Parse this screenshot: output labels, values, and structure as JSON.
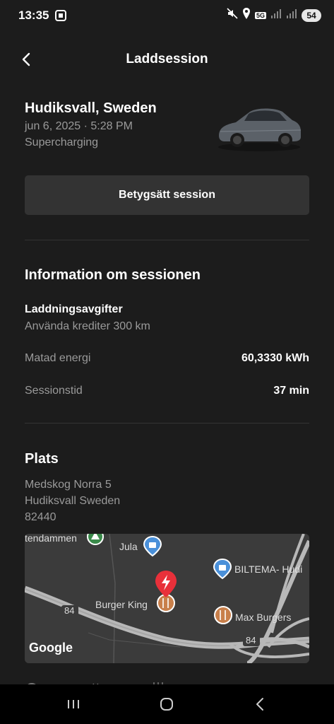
{
  "status": {
    "time": "13:35",
    "network": "5G",
    "battery": "54"
  },
  "header": {
    "title": "Laddsession"
  },
  "location": {
    "title": "Hudiksvall, Sweden",
    "datetime": "jun 6, 2025 · 5:28 PM",
    "type": "Supercharging"
  },
  "rate_button": "Betygsätt session",
  "session_info": {
    "title": "Information om sessionen",
    "fees_label": "Laddningsavgifter",
    "fees_value": "Använda krediter 300 km",
    "rows": [
      {
        "label": "Matad energi",
        "value": "60,3330 kWh"
      },
      {
        "label": "Sessionstid",
        "value": "37 min"
      }
    ]
  },
  "place": {
    "title": "Plats",
    "address": [
      "Medskog Norra 5",
      "Hudiksvall Sweden",
      "82440"
    ]
  },
  "map": {
    "labels": {
      "tendammen": "tendammen",
      "jula": "Jula",
      "biltema": "BILTEMA- Hudi",
      "burger_king": "Burger King",
      "max_burgers": "Max Burgers",
      "road_84_a": "84",
      "road_84_b": "84",
      "google": "Google"
    }
  },
  "colors": {
    "background": "#1c1c1c",
    "button": "#333333",
    "muted_text": "#9a9a9a",
    "charger_pin": "#e8303a",
    "food_pin": "#c87f4a",
    "shop_pin": "#4a90d9",
    "park_pin": "#3a8a4a"
  }
}
